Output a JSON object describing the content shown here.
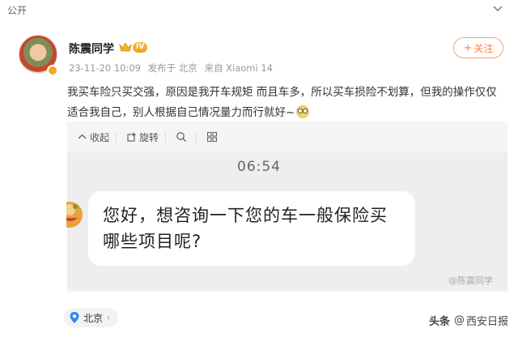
{
  "topbar": {
    "visibility": "公开"
  },
  "post": {
    "username": "陈震同学",
    "vip_level": "IV",
    "timestamp": "23-11-20 10:09",
    "published_from": "发布于 北京",
    "device": "来自 Xiaomi 14",
    "follow_label": "关注",
    "text": "我买车险只买交强，原因是我开车规矩 而且车多，所以买车损险不划算，但我的操作仅仅适合我自己，别人根据自己情况量力而行就好~"
  },
  "image_toolbar": {
    "collect": "收起",
    "rotate": "旋转"
  },
  "chat_image": {
    "time": "06:54",
    "message": "您好，想咨询一下您的车一般保险买哪些项目呢?",
    "watermark": "@陈震同学"
  },
  "location": {
    "city": "北京"
  },
  "credit": {
    "platform": "头条",
    "source": "西安日报"
  },
  "colors": {
    "accent": "#ff8140",
    "location_blue": "#2f88f4"
  },
  "icons": [
    "chevron-down-icon",
    "vip-crown-icon",
    "collapse-icon",
    "rotate-icon",
    "zoom-icon",
    "grid-icon",
    "location-pin-icon"
  ]
}
